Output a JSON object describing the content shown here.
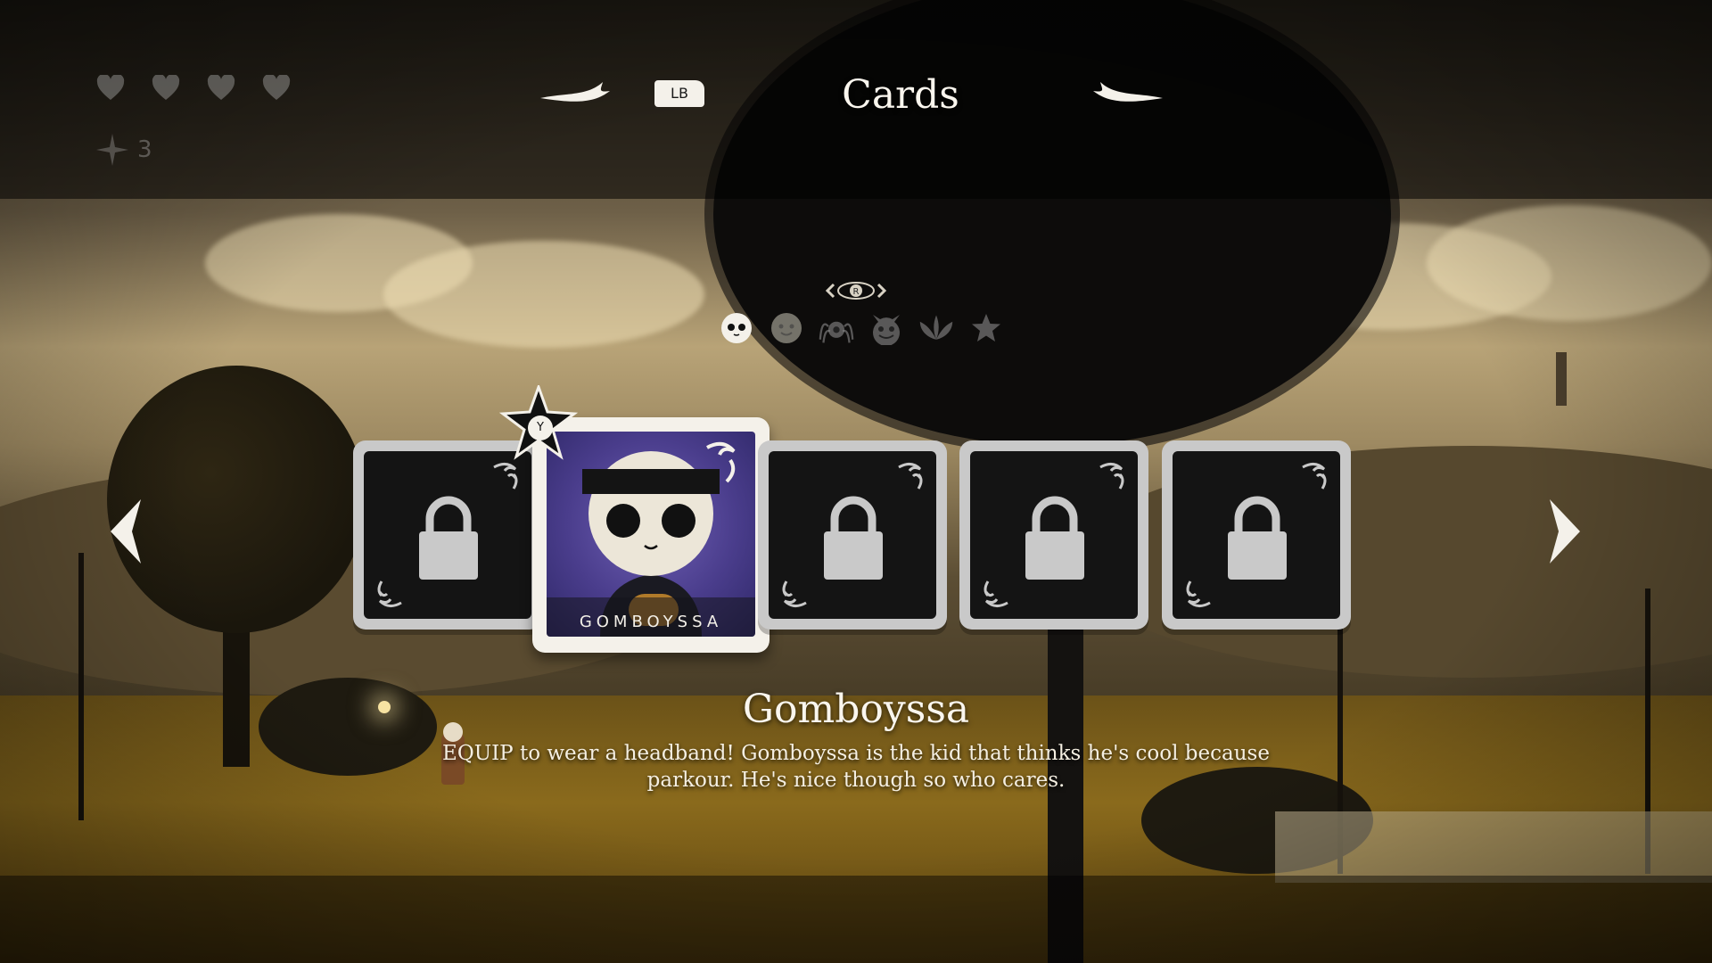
{
  "hud": {
    "hearts": 4,
    "sparkle_count": "3"
  },
  "header": {
    "prev_tab_button": "LB",
    "title": "Cards"
  },
  "filter_bar": {
    "cycle_hint": "R",
    "categories": [
      {
        "icon": "skull-face-icon",
        "active": true
      },
      {
        "icon": "smile-face-icon",
        "active": false
      },
      {
        "icon": "spider-icon",
        "active": false
      },
      {
        "icon": "demon-face-icon",
        "active": false
      },
      {
        "icon": "leaf-icon",
        "active": false
      },
      {
        "icon": "star-icon",
        "active": false
      }
    ]
  },
  "cards": {
    "equip_button": "Y",
    "items": [
      {
        "locked": true
      },
      {
        "locked": false,
        "name": "GOMBOYSSA"
      },
      {
        "locked": true
      },
      {
        "locked": true
      },
      {
        "locked": true
      }
    ]
  },
  "detail": {
    "title": "Gomboyssa",
    "description": "EQUIP to wear a headband! Gomboyssa is the kid that thinks he's cool because parkour. He's nice though so who cares."
  },
  "colors": {
    "card_art_bg": "#4a3d8c",
    "card_frame": "#f4f1ea",
    "locked_frame": "#c9c9c9"
  }
}
